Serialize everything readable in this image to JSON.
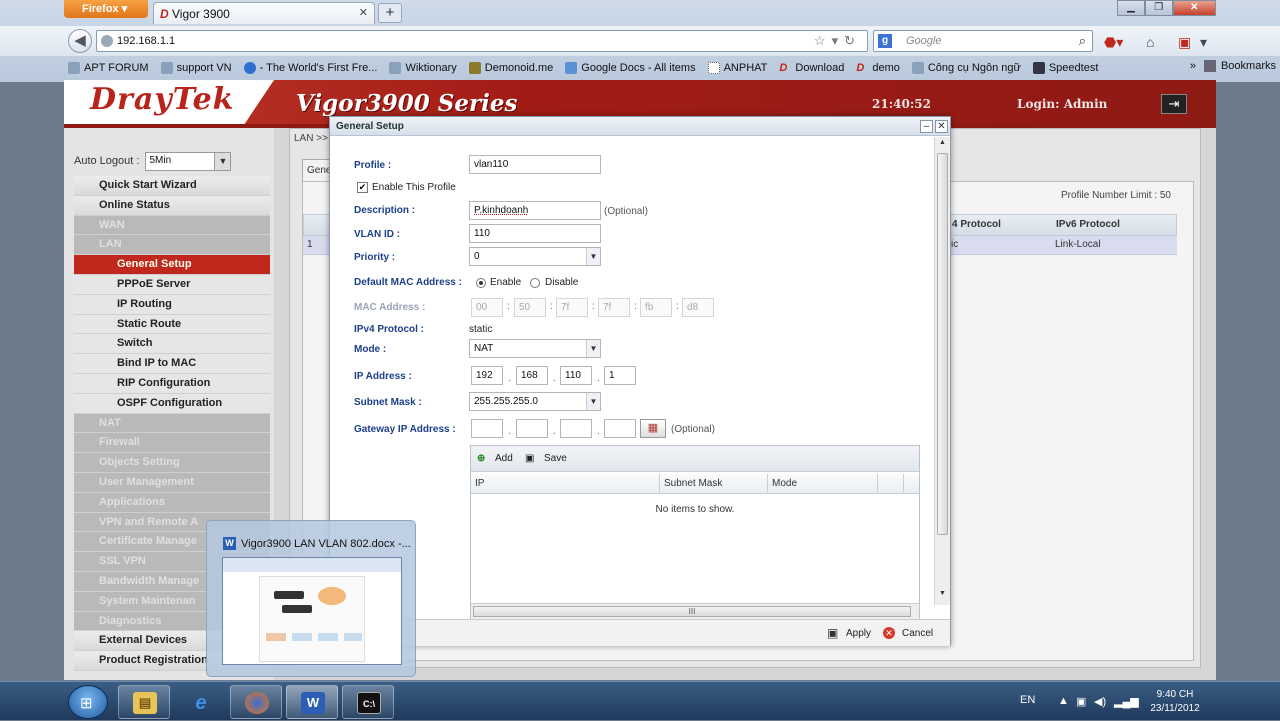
{
  "browser": {
    "app_button": "Firefox",
    "tab_title": "Vigor 3900",
    "url": "192.168.1.1",
    "search_placeholder": "Google",
    "bookmarks": [
      "APT FORUM",
      "support VN",
      "- The World's First Fre...",
      "Wiktionary",
      "Demonoid.me",
      "Google Docs - All items",
      "ANPHAT",
      "Download",
      "demo",
      "Công cụ Ngôn ngữ",
      "Speedtest"
    ],
    "bookmarks_label": "Bookmarks"
  },
  "header": {
    "logo": "DrayTek",
    "series": "Vigor3900 Series",
    "time": "21:40:52",
    "login": "Login: Admin"
  },
  "sidebar": {
    "auto_logout_label": "Auto Logout :",
    "auto_logout_value": "5Min",
    "items": [
      {
        "label": "Quick Start Wizard",
        "style": "top"
      },
      {
        "label": "Online Status",
        "style": "top"
      },
      {
        "label": "WAN",
        "style": "grey"
      },
      {
        "label": "LAN",
        "style": "grey"
      },
      {
        "label": "General Setup",
        "style": "active"
      },
      {
        "label": "PPPoE Server",
        "style": "sub"
      },
      {
        "label": "IP Routing",
        "style": "sub"
      },
      {
        "label": "Static Route",
        "style": "sub"
      },
      {
        "label": "Switch",
        "style": "sub"
      },
      {
        "label": "Bind IP to MAC",
        "style": "sub"
      },
      {
        "label": "RIP Configuration",
        "style": "sub"
      },
      {
        "label": "OSPF Configuration",
        "style": "sub"
      },
      {
        "label": "NAT",
        "style": "grey"
      },
      {
        "label": "Firewall",
        "style": "grey"
      },
      {
        "label": "Objects Setting",
        "style": "grey"
      },
      {
        "label": "User Management",
        "style": "grey"
      },
      {
        "label": "Applications",
        "style": "grey"
      },
      {
        "label": "VPN and Remote A",
        "style": "grey"
      },
      {
        "label": "Certificate Manage",
        "style": "grey"
      },
      {
        "label": "SSL VPN",
        "style": "grey"
      },
      {
        "label": "Bandwidth Manage",
        "style": "grey"
      },
      {
        "label": "System Maintenan",
        "style": "grey"
      },
      {
        "label": "Diagnostics",
        "style": "grey"
      },
      {
        "label": "External Devices",
        "style": "top"
      },
      {
        "label": "Product Registration",
        "style": "top"
      }
    ]
  },
  "content": {
    "breadcrumb": "LAN >> G",
    "tab": "Gene",
    "profile_limit": "Profile Number Limit : 50",
    "col_ipv4": "4 Protocol",
    "col_ipv6": "IPv6 Protocol",
    "row_num": "1",
    "row_ipv4": "ic",
    "row_ipv6": "Link-Local"
  },
  "dialog": {
    "title": "General Setup",
    "profile_label": "Profile :",
    "profile_value": "vlan110",
    "enable_label": "Enable This Profile",
    "enable_checked": true,
    "description_label": "Description :",
    "description_value": "P.kinhdoanh",
    "optional": "(Optional)",
    "vlan_label": "VLAN ID :",
    "vlan_value": "110",
    "priority_label": "Priority :",
    "priority_value": "0",
    "default_mac_label": "Default MAC Address :",
    "enable_opt": "Enable",
    "disable_opt": "Disable",
    "default_mac_selected": "Enable",
    "mac_label": "MAC Address :",
    "mac": [
      "00",
      "50",
      "7f",
      "7f",
      "fb",
      "d8"
    ],
    "ipv4_label": "IPv4 Protocol :",
    "ipv4_value": "static",
    "mode_label": "Mode :",
    "mode_value": "NAT",
    "ip_label": "IP Address :",
    "ip": [
      "192",
      "168",
      "110",
      "1"
    ],
    "subnet_label": "Subnet Mask :",
    "subnet_value": "255.255.255.0",
    "gateway_label": "Gateway IP Address :",
    "gateway_optional": "(Optional)",
    "grid": {
      "add": "Add",
      "save": "Save",
      "columns": [
        "IP",
        "Subnet Mask",
        "Mode"
      ],
      "empty": "No items to show.",
      "hscroll_glyph": "III"
    },
    "apply": "Apply",
    "cancel": "Cancel"
  },
  "taskbar": {
    "thumb_title": "Vigor3900 LAN VLAN 802.docx -...",
    "lang": "EN",
    "time": "9:40 CH",
    "date": "23/11/2012"
  }
}
